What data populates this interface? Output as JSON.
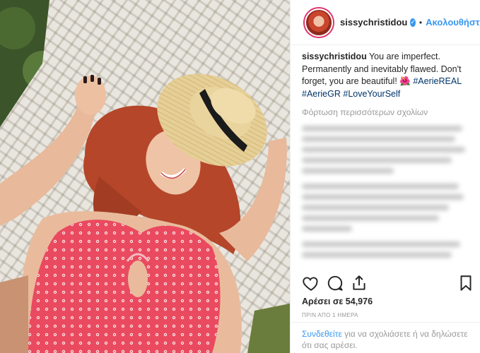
{
  "post": {
    "username": "sissychristidou",
    "verified_glyph": "✓",
    "separator": "•",
    "follow_label": "Ακολουθήστε",
    "caption": {
      "username": "sissychristidou",
      "text": "You are imperfect. Permanently and inevitably flawed. Don't forget, you are beautiful!",
      "emoji": "🌺",
      "hashtags": [
        "#AerieREAL",
        "#AerieGR",
        "#LoveYourSelf"
      ]
    },
    "load_more_comments": "Φόρτωση περισσότερων σχολίων",
    "likes_label": "Αρέσει σε 54,976",
    "timestamp": "ΠΡΙΝ ΑΠΟ 1 ΗΜΕΡΑ",
    "footer": {
      "login_link": "Συνδεθείτε",
      "text": " για να σχολιάσετε ή να δηλώσετε ότι σας αρέσει."
    }
  },
  "icons": {
    "like": "heart-icon",
    "comment": "comment-icon",
    "share": "share-icon",
    "save": "bookmark-icon"
  },
  "colors": {
    "link_blue": "#3897f0",
    "hashtag": "#003569",
    "muted": "#999999",
    "swimsuit": "#e83a52"
  }
}
